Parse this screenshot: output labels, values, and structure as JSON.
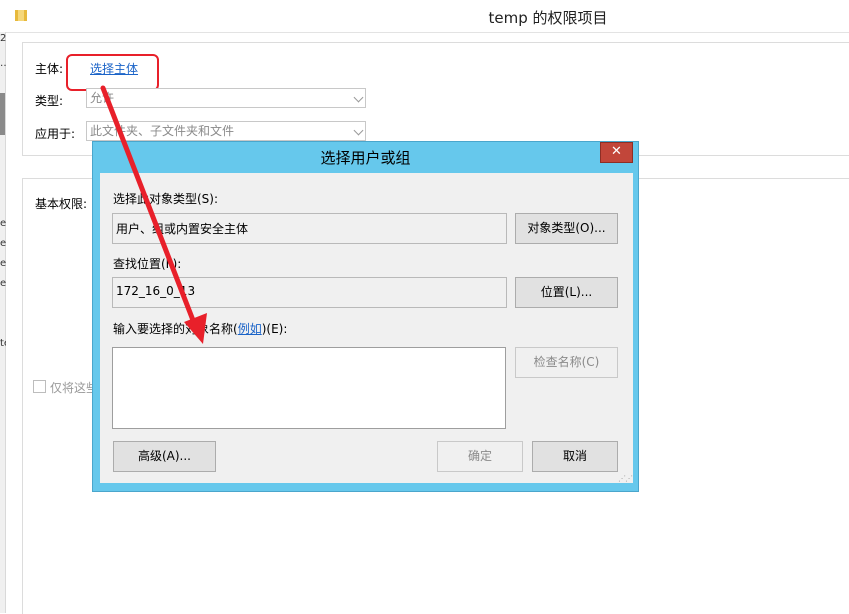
{
  "window": {
    "title": "temp 的权限项目"
  },
  "left_strip": {
    "chars": [
      "2",
      "…",
      "e",
      "e",
      "e",
      "e",
      "te"
    ]
  },
  "form": {
    "principal_label": "主体:",
    "select_principal_link": "选择主体",
    "type_label": "类型:",
    "type_value": "允许",
    "apply_label": "应用于:",
    "apply_value": "此文件夹、子文件夹和文件",
    "basic_permissions_label": "基本权限:",
    "only_apply_label": "仅将这些"
  },
  "dialog": {
    "title": "选择用户或组",
    "close_glyph": "✕",
    "object_type_label": "选择此对象类型(S):",
    "object_type_value": "用户、组或内置安全主体",
    "object_types_button": "对象类型(O)...",
    "location_label": "查找位置(F):",
    "location_value": "172_16_0_13",
    "location_button": "位置(L)...",
    "enter_label_prefix": "输入要选择的对象名称(",
    "enter_label_link": "例如",
    "enter_label_suffix": ")(E):",
    "names_value": "",
    "check_names_button": "检查名称(C)",
    "advanced_button": "高级(A)...",
    "ok_button": "确定",
    "cancel_button": "取消"
  },
  "colors": {
    "dialog_frame": "#66c8ec",
    "close_button": "#c2463a",
    "link": "#1a63c8",
    "annotation_red": "#e8202a"
  }
}
